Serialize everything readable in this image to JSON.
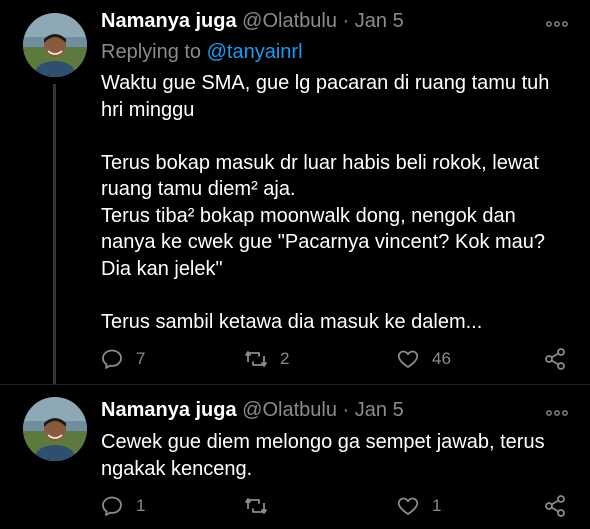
{
  "tweets": [
    {
      "author_name": "Namanya juga",
      "handle": "@Olatbulu",
      "separator": "·",
      "date": "Jan 5",
      "replying_to_label": "Replying to",
      "replying_to_handle": "@tanyainrl",
      "text": "Waktu gue SMA, gue lg pacaran di ruang tamu tuh hri minggu\n\nTerus bokap masuk dr luar habis beli rokok, lewat ruang tamu diem² aja.\nTerus tiba² bokap moonwalk dong, nengok dan nanya ke cwek gue \"Pacarnya vincent? Kok mau? Dia kan jelek\"\n\nTerus sambil ketawa dia masuk ke dalem...",
      "replies": "7",
      "retweets": "2",
      "likes": "46"
    },
    {
      "author_name": "Namanya juga",
      "handle": "@Olatbulu",
      "separator": "·",
      "date": "Jan 5",
      "text": "Cewek gue diem melongo ga sempet jawab, terus ngakak kenceng.",
      "replies": "1",
      "retweets": "",
      "likes": "1"
    }
  ],
  "icons": {
    "more": "more-icon",
    "reply": "reply-icon",
    "retweet": "retweet-icon",
    "like": "heart-icon",
    "share": "share-icon"
  },
  "colors": {
    "background": "#000000",
    "text": "#ffffff",
    "muted": "#8b8b8b",
    "link": "#1d9bf0"
  }
}
